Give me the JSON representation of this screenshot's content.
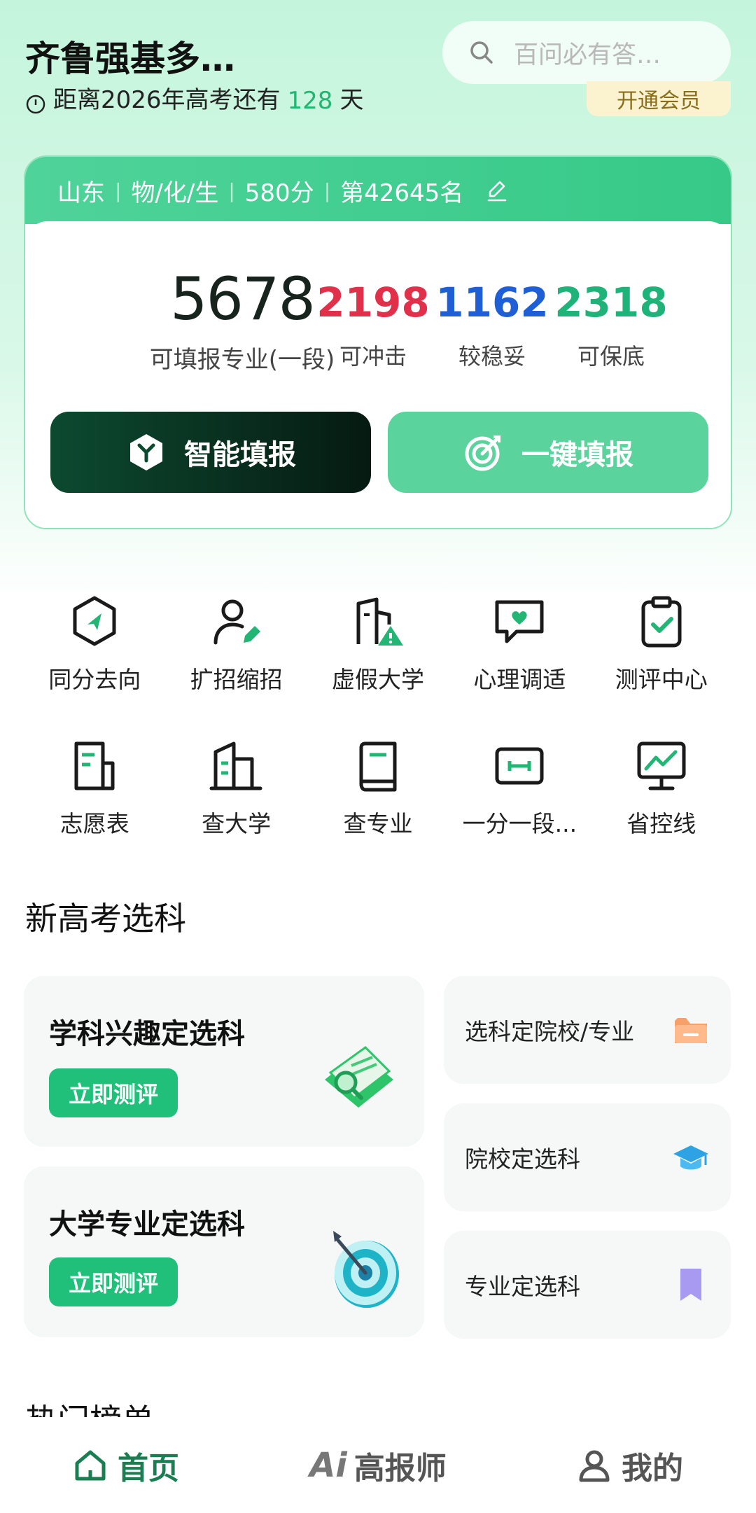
{
  "header": {
    "title": "齐鲁强基多…",
    "search_placeholder": "百问必有答…",
    "countdown_prefix": "距离2026年高考还有",
    "countdown_days": "128",
    "countdown_suffix": "天",
    "member_label": "开通会员"
  },
  "score": {
    "province": "山东",
    "subjects": "物/化/生",
    "score": "580分",
    "rank": "第42645名",
    "total": "5678",
    "total_label": "可填报专业(一段)",
    "stats": [
      {
        "value": "2198",
        "label": "可冲击",
        "color": "#e0304a"
      },
      {
        "value": "1162",
        "label": "较稳妥",
        "color": "#1e5fd6"
      },
      {
        "value": "2318",
        "label": "可保底",
        "color": "#1fb37a"
      }
    ],
    "btn_ai": "智能填报",
    "btn_one": "一键填报"
  },
  "grid": [
    {
      "label": "同分去向",
      "icon": "hexagon-navigation-icon"
    },
    {
      "label": "扩招缩招",
      "icon": "user-edit-icon"
    },
    {
      "label": "虚假大学",
      "icon": "building-warning-icon"
    },
    {
      "label": "心理调适",
      "icon": "chat-heart-icon"
    },
    {
      "label": "测评中心",
      "icon": "clipboard-check-icon"
    },
    {
      "label": "志愿表",
      "icon": "document-icon"
    },
    {
      "label": "查大学",
      "icon": "buildings-icon"
    },
    {
      "label": "查专业",
      "icon": "book-icon"
    },
    {
      "label": "一分一段...",
      "icon": "ruler-icon"
    },
    {
      "label": "省控线",
      "icon": "monitor-chart-icon"
    }
  ],
  "section": {
    "title": "新高考选科",
    "card1_title": "学科兴趣定选科",
    "card1_btn": "立即测评",
    "card2_title": "大学专业定选科",
    "card2_btn": "立即测评",
    "side1": "选科定院校/专业",
    "side2": "院校定选科",
    "side3": "专业定选科"
  },
  "hot_title": "热门榜单",
  "nav": {
    "home": "首页",
    "ai_prefix": "Ai",
    "ai": "高报师",
    "mine": "我的"
  },
  "colors": {
    "accent": "#20c07a",
    "nav_active": "#1b7d52"
  }
}
